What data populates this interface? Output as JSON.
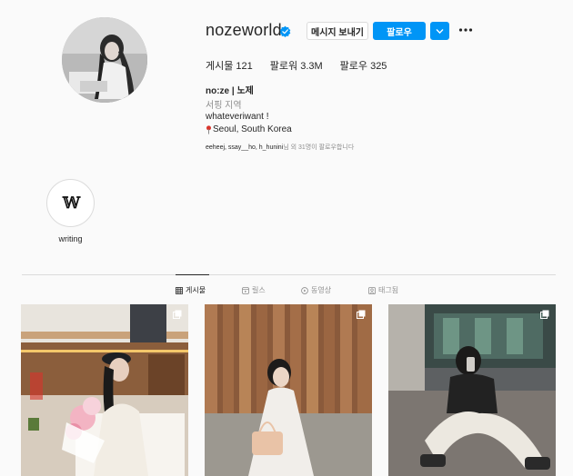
{
  "profile": {
    "username": "nozeworld",
    "verified": true,
    "buttons": {
      "message": "메시지 보내기",
      "follow": "팔로우"
    },
    "stats": {
      "posts": "게시물 121",
      "followers": "팔로워 3.3M",
      "following": "팔로우 325"
    },
    "bio": {
      "name": "no:ze | 노제",
      "category": "서핑 지역",
      "line": "whateveriwant !",
      "location": "Seoul, South Korea"
    },
    "followed_by_users": "eeheej, ssay__ho, h_hunini",
    "followed_by_suffix": "님 외 31명이 팔로우합니다"
  },
  "highlights": [
    {
      "label": "writing",
      "cover_text": "𝕎"
    }
  ],
  "tabs": [
    {
      "label": "게시물",
      "icon": "grid-icon",
      "active": true
    },
    {
      "label": "릴스",
      "icon": "reels-icon",
      "active": false
    },
    {
      "label": "동영상",
      "icon": "video-icon",
      "active": false
    },
    {
      "label": "태그됨",
      "icon": "tagged-icon",
      "active": false
    }
  ],
  "colors": {
    "accent": "#0095f6",
    "text": "#262626",
    "muted": "#8e8e8e",
    "border": "#dbdbdb",
    "background": "#fafafa"
  }
}
